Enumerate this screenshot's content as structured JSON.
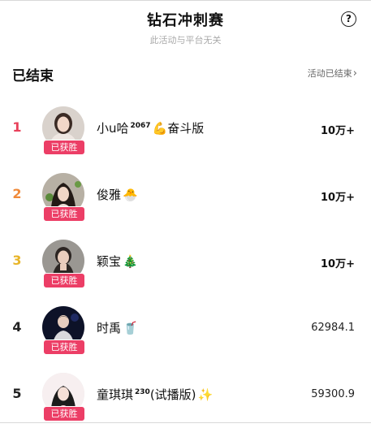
{
  "header": {
    "title": "钻石冲刺赛",
    "subtitle": "此活动与平台无关",
    "help_glyph": "?"
  },
  "section": {
    "title": "已结束",
    "link": "活动已结束",
    "link_chevron": "›"
  },
  "entries": [
    {
      "rank": "1",
      "rank_color": "#e8405a",
      "name": "小u哈",
      "sup": "2067",
      "emoji": "💪",
      "suffix": "奋斗版",
      "badge": "已获胜",
      "score": "10万+"
    },
    {
      "rank": "2",
      "rank_color": "#f08a3a",
      "name": "俊雅",
      "sup": "",
      "emoji": "🐣",
      "suffix": "",
      "badge": "已获胜",
      "score": "10万+"
    },
    {
      "rank": "3",
      "rank_color": "#e8b52a",
      "name": "颖宝",
      "sup": "",
      "emoji": "🎄",
      "suffix": "",
      "badge": "已获胜",
      "score": "10万+"
    },
    {
      "rank": "4",
      "rank_color": "#222222",
      "name": "时禹",
      "sup": "",
      "emoji": "🥤",
      "suffix": "",
      "badge": "已获胜",
      "score": "62984.1"
    },
    {
      "rank": "5",
      "rank_color": "#222222",
      "name": "童琪琪",
      "sup": "230",
      "emoji": "✨",
      "suffix": "(试播版)",
      "badge": "已获胜",
      "score": "59300.9"
    }
  ],
  "colors": {
    "badge": "#ec3e66",
    "accent": "#e8405a"
  }
}
